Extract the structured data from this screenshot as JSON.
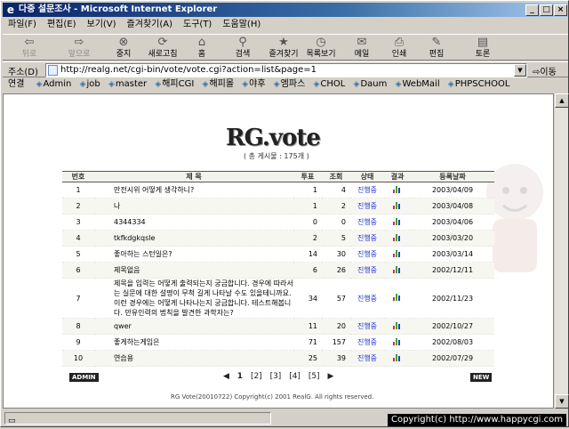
{
  "window": {
    "title": "다중 설문조사 - Microsoft Internet Explorer"
  },
  "menu": [
    "파일(F)",
    "편집(E)",
    "보기(V)",
    "즐겨찾기(A)",
    "도구(T)",
    "도움말(H)"
  ],
  "toolbar": {
    "back": "뒤로",
    "forward": "앞으로",
    "stop": "중지",
    "refresh": "새로고침",
    "home": "홈",
    "search": "검색",
    "favorites": "즐겨찾기",
    "history": "목록보기",
    "mail": "메일",
    "print": "인쇄",
    "edit": "편집",
    "discuss": "토론"
  },
  "address": {
    "label": "주소(D)",
    "url": "http://realg.net/cgi-bin/vote/vote.cgi?action=list&page=1",
    "go": "이동"
  },
  "links": {
    "label": "연결",
    "items": [
      "Admin",
      "job",
      "master",
      "해피CGI",
      "해피몰",
      "야후",
      "엠파스",
      "CHOL",
      "Daum",
      "WebMail",
      "PHPSCHOOL"
    ]
  },
  "page": {
    "logo": "RG.vote",
    "count": "( 총 게시물 : 175개 )",
    "headers": [
      "번호",
      "제 목",
      "투표",
      "조회",
      "상태",
      "결과",
      "등록날짜"
    ],
    "rows": [
      {
        "no": "1",
        "subject": "만전시위 어떻게 생각하니?",
        "votes": "1",
        "views": "4",
        "state": "진행중",
        "date": "2003/04/09"
      },
      {
        "no": "2",
        "subject": "나",
        "votes": "1",
        "views": "2",
        "state": "진행중",
        "date": "2003/04/08"
      },
      {
        "no": "3",
        "subject": "4344334",
        "votes": "0",
        "views": "0",
        "state": "진행중",
        "date": "2003/04/06"
      },
      {
        "no": "4",
        "subject": "tkfkdgkqsle",
        "votes": "2",
        "views": "5",
        "state": "진행중",
        "date": "2003/03/20"
      },
      {
        "no": "5",
        "subject": "좋아하는 스턴일은?",
        "votes": "14",
        "views": "30",
        "state": "진행중",
        "date": "2003/03/14"
      },
      {
        "no": "6",
        "subject": "제목없음",
        "votes": "6",
        "views": "26",
        "state": "진행중",
        "date": "2002/12/11"
      },
      {
        "no": "7",
        "subject": "제목을 입력는 어떻게 출력되는지 궁금합니다. 경우에 따라서는 실문에 대한 설명이 무척 길게 나타날 수도 있을테니까요. 이런 경우에는 어떻게 나타나는지 궁금합니다. 테스트해봅니다. 만유인력의 법칙을 발견한 과학자는?",
        "votes": "34",
        "views": "57",
        "state": "진행중",
        "date": "2002/11/23"
      },
      {
        "no": "8",
        "subject": "qwer",
        "votes": "11",
        "views": "20",
        "state": "진행중",
        "date": "2002/10/27"
      },
      {
        "no": "9",
        "subject": "좋게하는게임은",
        "votes": "71",
        "views": "157",
        "state": "진행중",
        "date": "2002/08/03"
      },
      {
        "no": "10",
        "subject": "연습용",
        "votes": "25",
        "views": "39",
        "state": "진행중",
        "date": "2002/07/29"
      }
    ],
    "admin": "ADMIN",
    "new": "NEW",
    "paging": {
      "prev": "◀",
      "pages": [
        "1",
        "[2]",
        "[3]",
        "[4]",
        "[5]"
      ],
      "next": "▶"
    },
    "footer": "RG Vote(20010722) Copyright(c) 2001 RealG. All rights reserved."
  },
  "copyright": "Copyright(c) http://www.happycgi.com"
}
